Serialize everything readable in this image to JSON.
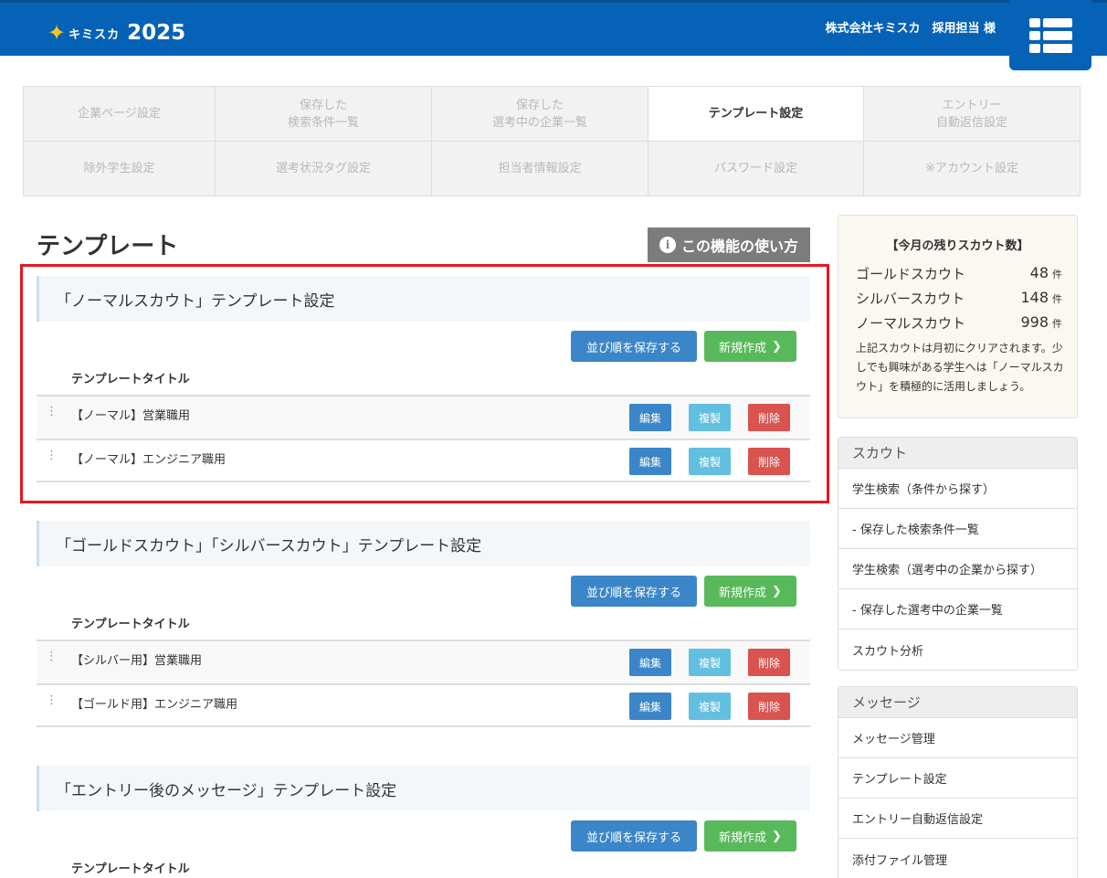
{
  "header": {
    "brand": "キミスカ",
    "year": "2025",
    "user_name": "株式会社キミスカ　採用担当 様",
    "menu_icon": "grid-menu-icon"
  },
  "settings_nav": [
    {
      "label": "企業ページ設定",
      "active": false
    },
    {
      "label": "保存した\n検索条件一覧",
      "active": false
    },
    {
      "label": "保存した\n選考中の企業一覧",
      "active": false
    },
    {
      "label": "テンプレート設定",
      "active": true
    },
    {
      "label": "エントリー\n自動返信設定",
      "active": false
    },
    {
      "label": "除外学生設定",
      "active": false
    },
    {
      "label": "選考状況タグ設定",
      "active": false
    },
    {
      "label": "担当者情報設定",
      "active": false
    },
    {
      "label": "パスワード設定",
      "active": false
    },
    {
      "label": "※アカウント設定",
      "active": false
    }
  ],
  "page": {
    "title": "テンプレート",
    "howto_label": "この機能の使い方"
  },
  "sections": [
    {
      "heading": "「ノーマルスカウト」テンプレート設定",
      "save_label": "並び順を保存する",
      "new_label": "新規作成",
      "column_header": "テンプレートタイトル",
      "rows": [
        {
          "title": "【ノーマル】営業職用",
          "edit": "編集",
          "copy": "複製",
          "delete": "削除"
        },
        {
          "title": "【ノーマル】エンジニア職用",
          "edit": "編集",
          "copy": "複製",
          "delete": "削除"
        }
      ]
    },
    {
      "heading": "「ゴールドスカウト」「シルバースカウト」テンプレート設定",
      "save_label": "並び順を保存する",
      "new_label": "新規作成",
      "column_header": "テンプレートタイトル",
      "rows": [
        {
          "title": "【シルバー用】営業職用",
          "edit": "編集",
          "copy": "複製",
          "delete": "削除"
        },
        {
          "title": "【ゴールド用】エンジニア職用",
          "edit": "編集",
          "copy": "複製",
          "delete": "削除"
        }
      ]
    },
    {
      "heading": "「エントリー後のメッセージ」テンプレート設定",
      "save_label": "並び順を保存する",
      "new_label": "新規作成",
      "column_header": "テンプレートタイトル",
      "rows": []
    }
  ],
  "quota": {
    "title": "【今月の残りスカウト数】",
    "unit": "件",
    "items": [
      {
        "label": "ゴールドスカウト",
        "count": "48"
      },
      {
        "label": "シルバースカウト",
        "count": "148"
      },
      {
        "label": "ノーマルスカウト",
        "count": "998"
      }
    ],
    "note": "上記スカウトは月初にクリアされます。少しでも興味がある学生へは「ノーマルスカウト」を積極的に活用しましょう。"
  },
  "sidebar": {
    "scout": {
      "heading": "スカウト",
      "items": [
        "学生検索（条件から探す）",
        "- 保存した検索条件一覧",
        "学生検索（選考中の企業から探す）",
        "- 保存した選考中の企業一覧",
        "スカウト分析"
      ]
    },
    "message": {
      "heading": "メッセージ",
      "items": [
        "メッセージ管理",
        "テンプレート設定",
        "エントリー自動返信設定",
        "添付ファイル管理"
      ]
    }
  },
  "colors": {
    "header_blue": "#0662b6",
    "save_button": "#3b86c8",
    "new_button": "#58b95a",
    "copy_button": "#62bfe0",
    "delete_button": "#d9534f",
    "highlight_red": "#e5161f"
  }
}
